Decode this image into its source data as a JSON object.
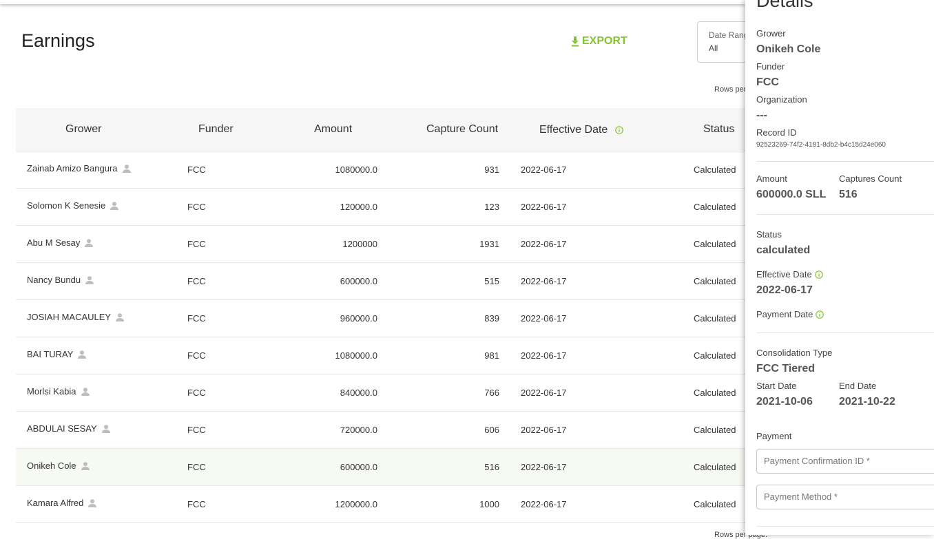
{
  "page": {
    "title": "Earnings",
    "export_label": "EXPORT",
    "date_range": {
      "label": "Date Range",
      "value": "All"
    },
    "rows_per_page_label": "Rows per page:"
  },
  "table": {
    "headers": {
      "grower": "Grower",
      "funder": "Funder",
      "amount": "Amount",
      "capture_count": "Capture Count",
      "effective_date": "Effective Date",
      "status": "Status"
    },
    "rows": [
      {
        "grower": "Zainab Amizo Bangura",
        "funder": "FCC",
        "amount": "1080000.0",
        "capture_count": "931",
        "effective_date": "2022-06-17",
        "status": "Calculated"
      },
      {
        "grower": "Solomon K Senesie",
        "funder": "FCC",
        "amount": "120000.0",
        "capture_count": "123",
        "effective_date": "2022-06-17",
        "status": "Calculated"
      },
      {
        "grower": "Abu M Sesay",
        "funder": "FCC",
        "amount": "1200000",
        "capture_count": "1931",
        "effective_date": "2022-06-17",
        "status": "Calculated"
      },
      {
        "grower": "Nancy Bundu",
        "funder": "FCC",
        "amount": "600000.0",
        "capture_count": "515",
        "effective_date": "2022-06-17",
        "status": "Calculated"
      },
      {
        "grower": "JOSIAH MACAULEY",
        "funder": "FCC",
        "amount": "960000.0",
        "capture_count": "839",
        "effective_date": "2022-06-17",
        "status": "Calculated"
      },
      {
        "grower": "BAI TURAY",
        "funder": "FCC",
        "amount": "1080000.0",
        "capture_count": "981",
        "effective_date": "2022-06-17",
        "status": "Calculated"
      },
      {
        "grower": "Morlsi Kabia",
        "funder": "FCC",
        "amount": "840000.0",
        "capture_count": "766",
        "effective_date": "2022-06-17",
        "status": "Calculated"
      },
      {
        "grower": "ABDULAI SESAY",
        "funder": "FCC",
        "amount": "720000.0",
        "capture_count": "606",
        "effective_date": "2022-06-17",
        "status": "Calculated"
      },
      {
        "grower": "Onikeh Cole",
        "funder": "FCC",
        "amount": "600000.0",
        "capture_count": "516",
        "effective_date": "2022-06-17",
        "status": "Calculated"
      },
      {
        "grower": "Kamara Alfred",
        "funder": "FCC",
        "amount": "1200000.0",
        "capture_count": "1000",
        "effective_date": "2022-06-17",
        "status": "Calculated"
      }
    ]
  },
  "details": {
    "title": "Details",
    "grower_label": "Grower",
    "grower": "Onikeh Cole",
    "funder_label": "Funder",
    "funder": "FCC",
    "organization_label": "Organization",
    "organization": "---",
    "record_id_label": "Record ID",
    "record_id": "92523269-74f2-4181-8db2-b4c15d24e060",
    "amount_label": "Amount",
    "amount": "600000.0 SLL",
    "captures_count_label": "Captures Count",
    "captures_count": "516",
    "status_label": "Status",
    "status": "calculated",
    "effective_date_label": "Effective Date",
    "effective_date": "2022-06-17",
    "payment_date_label": "Payment Date",
    "consolidation_type_label": "Consolidation Type",
    "consolidation_type": "FCC Tiered",
    "start_date_label": "Start Date",
    "start_date": "2021-10-06",
    "end_date_label": "End Date",
    "end_date": "2021-10-22",
    "payment_label": "Payment",
    "payment_confirmation_placeholder": "Payment Confirmation ID *",
    "payment_method_placeholder": "Payment Method *"
  },
  "colors": {
    "accent": "#86c232"
  },
  "icons": {
    "export": "download-icon",
    "person": "person-icon",
    "info": "info-icon"
  }
}
